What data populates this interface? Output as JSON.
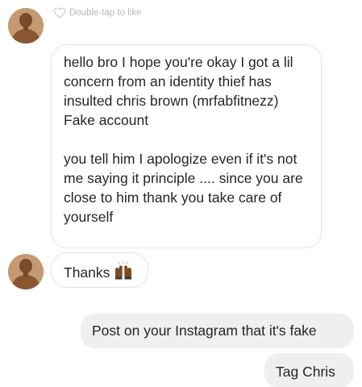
{
  "thread": {
    "like_hint": "Double-tap to like",
    "messages": [
      {
        "paragraphs": [
          "hello bro I hope you're okay I got a lil concern from an identity thief has insulted chris brown (mrfabfitnezz) Fake account",
          "you tell him I apologize even if it's not me saying it principle .... since you are close to him thank you take care of yourself"
        ]
      },
      {
        "text": "Thanks",
        "emoji": "raised-hands-emoji"
      },
      {
        "text": "Post on your Instagram that it's fake"
      },
      {
        "text": "Tag Chris"
      }
    ]
  },
  "icons": {
    "like": "heart-outline-icon",
    "avatar": "user-avatar"
  },
  "colors": {
    "incoming_bubble_border": "#e4e4e4",
    "outgoing_bubble_bg": "#efefef",
    "hint_text": "#b9b9b9",
    "text": "#262626"
  }
}
